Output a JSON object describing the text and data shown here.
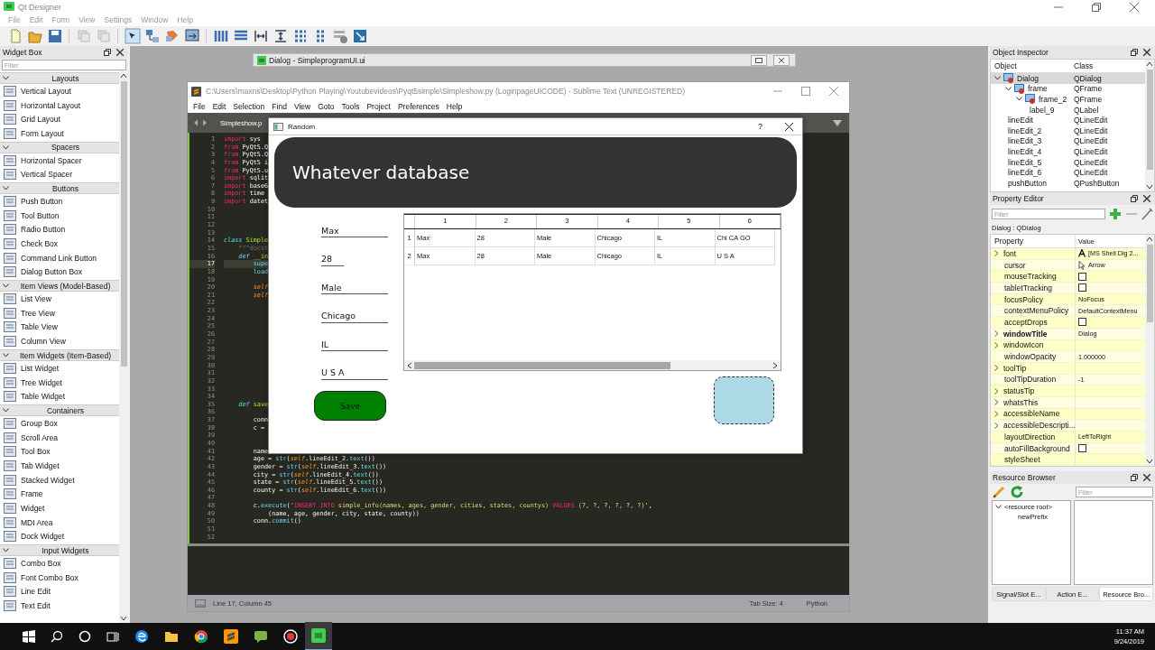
{
  "designer": {
    "title": "Qt Designer",
    "menu": [
      "File",
      "Edit",
      "Form",
      "View",
      "Settings",
      "Window",
      "Help"
    ]
  },
  "widget_box": {
    "title": "Widget Box",
    "filter_placeholder": "Filter",
    "groups": [
      {
        "label": "Layouts",
        "expanded": true,
        "items": [
          "Vertical Layout",
          "Horizontal Layout",
          "Grid Layout",
          "Form Layout"
        ]
      },
      {
        "label": "Spacers",
        "expanded": true,
        "items": [
          "Horizontal Spacer",
          "Vertical Spacer"
        ]
      },
      {
        "label": "Buttons",
        "expanded": true,
        "items": [
          "Push Button",
          "Tool Button",
          "Radio Button",
          "Check Box",
          "Command Link Button",
          "Dialog Button Box"
        ]
      },
      {
        "label": "Item Views (Model-Based)",
        "expanded": true,
        "items": [
          "List View",
          "Tree View",
          "Table View",
          "Column View"
        ]
      },
      {
        "label": "Item Widgets (Item-Based)",
        "expanded": true,
        "items": [
          "List Widget",
          "Tree Widget",
          "Table Widget"
        ]
      },
      {
        "label": "Containers",
        "expanded": true,
        "items": [
          "Group Box",
          "Scroll Area",
          "Tool Box",
          "Tab Widget",
          "Stacked Widget",
          "Frame",
          "Widget",
          "MDI Area",
          "Dock Widget"
        ]
      },
      {
        "label": "Input Widgets",
        "expanded": true,
        "items": [
          "Combo Box",
          "Font Combo Box",
          "Line Edit",
          "Text Edit"
        ]
      }
    ]
  },
  "form_window": {
    "title": "Dialog - SimpleprogramUI.ui"
  },
  "editor": {
    "title": "C:\\Users\\maxns\\Desktop\\Python Playing\\Youtubevideos\\Pyqt5simple\\Simpleshow.py (LoginpageUICODE) - Sublime Text (UNREGISTERED)",
    "menu": [
      "File",
      "Edit",
      "Selection",
      "Find",
      "View",
      "Goto",
      "Tools",
      "Project",
      "Preferences",
      "Help"
    ],
    "tab": "Simpleshow.p",
    "lines": [
      {
        "number": "1",
        "current": false,
        "segments": [
          {
            "text": "import",
            "kind": "kw"
          },
          {
            "text": " sys",
            "kind": "plain"
          }
        ]
      },
      {
        "number": "2",
        "current": false,
        "segments": [
          {
            "text": "from",
            "kind": "kw"
          },
          {
            "text": " PyQt5.Q",
            "kind": "plain"
          }
        ]
      },
      {
        "number": "3",
        "current": false,
        "segments": [
          {
            "text": "from",
            "kind": "kw"
          },
          {
            "text": " PyQt5.Q",
            "kind": "plain"
          }
        ]
      },
      {
        "number": "4",
        "current": false,
        "segments": [
          {
            "text": "from",
            "kind": "kw"
          },
          {
            "text": " PyQt5 i",
            "kind": "plain"
          }
        ]
      },
      {
        "number": "5",
        "current": false,
        "segments": [
          {
            "text": "from",
            "kind": "kw"
          },
          {
            "text": " PyQt5.u",
            "kind": "plain"
          }
        ]
      },
      {
        "number": "6",
        "current": false,
        "segments": [
          {
            "text": "import",
            "kind": "kw"
          },
          {
            "text": " sqlit",
            "kind": "plain"
          }
        ]
      },
      {
        "number": "7",
        "current": false,
        "segments": [
          {
            "text": "import",
            "kind": "kw"
          },
          {
            "text": " base6",
            "kind": "plain"
          }
        ]
      },
      {
        "number": "8",
        "current": false,
        "segments": [
          {
            "text": "import",
            "kind": "kw"
          },
          {
            "text": " time",
            "kind": "plain"
          }
        ]
      },
      {
        "number": "9",
        "current": false,
        "segments": [
          {
            "text": "import",
            "kind": "kw"
          },
          {
            "text": " datet",
            "kind": "plain"
          }
        ]
      },
      {
        "number": "10",
        "current": false
      },
      {
        "number": "11",
        "current": false
      },
      {
        "number": "12",
        "current": false
      },
      {
        "number": "13",
        "current": false
      },
      {
        "number": "14",
        "current": false,
        "segments": [
          {
            "text": "class",
            "kind": "def"
          },
          {
            "text": " Simple",
            "kind": "name"
          }
        ]
      },
      {
        "number": "15",
        "current": false,
        "segments": [
          {
            "text": "    \"\"\"docst",
            "kind": "comment"
          }
        ]
      },
      {
        "number": "16",
        "current": false,
        "segments": [
          {
            "text": "    def",
            "kind": "def"
          },
          {
            "text": " __in",
            "kind": "name"
          }
        ]
      },
      {
        "number": "17",
        "current": true,
        "segments": [
          {
            "text": "        supe",
            "kind": "fn"
          }
        ]
      },
      {
        "number": "18",
        "current": false,
        "segments": [
          {
            "text": "        load",
            "kind": "fn"
          }
        ]
      },
      {
        "number": "19",
        "current": false
      },
      {
        "number": "20",
        "current": false,
        "segments": [
          {
            "text": "        self",
            "kind": "self"
          }
        ]
      },
      {
        "number": "21",
        "current": false,
        "segments": [
          {
            "text": "        self",
            "kind": "self"
          }
        ]
      },
      {
        "number": "22",
        "current": false
      },
      {
        "number": "23",
        "current": false
      },
      {
        "number": "24",
        "current": false
      },
      {
        "number": "25",
        "current": false
      },
      {
        "number": "26",
        "current": false
      },
      {
        "number": "27",
        "current": false
      },
      {
        "number": "28",
        "current": false
      },
      {
        "number": "29",
        "current": false
      },
      {
        "number": "30",
        "current": false
      },
      {
        "number": "31",
        "current": false
      },
      {
        "number": "32",
        "current": false
      },
      {
        "number": "33",
        "current": false
      },
      {
        "number": "34",
        "current": false
      },
      {
        "number": "35",
        "current": false,
        "segments": [
          {
            "text": "    def",
            "kind": "def"
          },
          {
            "text": " save",
            "kind": "name"
          }
        ]
      },
      {
        "number": "36",
        "current": false
      },
      {
        "number": "37",
        "current": false,
        "segments": [
          {
            "text": "        conn",
            "kind": "plain"
          }
        ]
      },
      {
        "number": "38",
        "current": false,
        "segments": [
          {
            "text": "        c =",
            "kind": "plain"
          }
        ]
      },
      {
        "number": "39",
        "current": false
      },
      {
        "number": "40",
        "current": false
      },
      {
        "number": "41",
        "current": false,
        "segments": [
          {
            "text": "        name",
            "kind": "plain"
          }
        ]
      },
      {
        "number": "42",
        "current": false,
        "segments": [
          {
            "text": "        age = ",
            "kind": "plain"
          },
          {
            "text": "str",
            "kind": "fn"
          },
          {
            "text": "(",
            "kind": "plain"
          },
          {
            "text": "self",
            "kind": "self"
          },
          {
            "text": ".lineEdit_2.",
            "kind": "plain"
          },
          {
            "text": "text",
            "kind": "fn"
          },
          {
            "text": "())",
            "kind": "plain"
          }
        ]
      },
      {
        "number": "43",
        "current": false,
        "segments": [
          {
            "text": "        gender = ",
            "kind": "plain"
          },
          {
            "text": "str",
            "kind": "fn"
          },
          {
            "text": "(",
            "kind": "plain"
          },
          {
            "text": "self",
            "kind": "self"
          },
          {
            "text": ".lineEdit_3.",
            "kind": "plain"
          },
          {
            "text": "text",
            "kind": "fn"
          },
          {
            "text": "())",
            "kind": "plain"
          }
        ]
      },
      {
        "number": "44",
        "current": false,
        "segments": [
          {
            "text": "        city = ",
            "kind": "plain"
          },
          {
            "text": "str",
            "kind": "fn"
          },
          {
            "text": "(",
            "kind": "plain"
          },
          {
            "text": "self",
            "kind": "self"
          },
          {
            "text": ".lineEdit_4.",
            "kind": "plain"
          },
          {
            "text": "text",
            "kind": "fn"
          },
          {
            "text": "())",
            "kind": "plain"
          }
        ]
      },
      {
        "number": "45",
        "current": false,
        "segments": [
          {
            "text": "        state = ",
            "kind": "plain"
          },
          {
            "text": "str",
            "kind": "fn"
          },
          {
            "text": "(",
            "kind": "plain"
          },
          {
            "text": "self",
            "kind": "self"
          },
          {
            "text": ".lineEdit_5.",
            "kind": "plain"
          },
          {
            "text": "text",
            "kind": "fn"
          },
          {
            "text": "())",
            "kind": "plain"
          }
        ]
      },
      {
        "number": "46",
        "current": false,
        "segments": [
          {
            "text": "        county = ",
            "kind": "plain"
          },
          {
            "text": "str",
            "kind": "fn"
          },
          {
            "text": "(",
            "kind": "plain"
          },
          {
            "text": "self",
            "kind": "self"
          },
          {
            "text": ".lineEdit_6.",
            "kind": "plain"
          },
          {
            "text": "text",
            "kind": "fn"
          },
          {
            "text": "())",
            "kind": "plain"
          }
        ]
      },
      {
        "number": "47",
        "current": false
      },
      {
        "number": "48",
        "current": false,
        "segments": [
          {
            "text": "        c.",
            "kind": "plain"
          },
          {
            "text": "execute",
            "kind": "fn"
          },
          {
            "text": "(",
            "kind": "plain"
          },
          {
            "text": "'",
            "kind": "str"
          },
          {
            "text": "INSERT INTO",
            "kind": "kw"
          },
          {
            "text": " simple_info(names, ages, gender, cities, states, countys) ",
            "kind": "str"
          },
          {
            "text": "VALUES",
            "kind": "kw"
          },
          {
            "text": " (?, ?, ?, ?, ?, ?)'",
            "kind": "str"
          },
          {
            "text": ",",
            "kind": "plain"
          }
        ]
      },
      {
        "number": "49",
        "current": false,
        "segments": [
          {
            "text": "            (name, age, gender, city, state, county))",
            "kind": "plain"
          }
        ]
      },
      {
        "number": "50",
        "current": false,
        "segments": [
          {
            "text": "        conn.",
            "kind": "plain"
          },
          {
            "text": "commit",
            "kind": "fn"
          },
          {
            "text": "()",
            "kind": "plain"
          }
        ]
      },
      {
        "number": "51",
        "current": false
      },
      {
        "number": "52",
        "current": false
      }
    ],
    "status": {
      "position": "Line 17, Column 45",
      "tab_size": "Tab Size: 4",
      "syntax": "Python"
    }
  },
  "dialog": {
    "title": "Random",
    "help": "?",
    "heading": "Whatever database",
    "fields": [
      "Max",
      "28",
      "Male",
      "Chicago",
      "IL",
      "U S A"
    ],
    "save_button": "Save",
    "table": {
      "columns": [
        "1",
        "2",
        "3",
        "4",
        "5",
        "6"
      ],
      "rows": [
        {
          "header": "1",
          "cells": [
            "Max",
            "28",
            "Male",
            "Chicago",
            "IL",
            "Chi CA GO"
          ]
        },
        {
          "header": "2",
          "cells": [
            "Max",
            "28",
            "Male",
            "Chicago",
            "IL",
            "U S A"
          ]
        }
      ]
    }
  },
  "object_inspector": {
    "title": "Object Inspector",
    "columns": [
      "Object",
      "Class"
    ],
    "objects": [
      {
        "name": "Dialog",
        "class": "QDialog",
        "selected": true,
        "expanded": true,
        "children": [
          {
            "name": "frame",
            "class": "QFrame",
            "selected": false,
            "expanded": true,
            "children": [
              {
                "name": "frame_2",
                "class": "QFrame",
                "selected": false,
                "expanded": true,
                "children": [
                  {
                    "name": "label_9",
                    "class": "QLabel",
                    "selected": false
                  }
                ]
              }
            ]
          },
          {
            "name": "lineEdit",
            "class": "QLineEdit",
            "selected": false
          },
          {
            "name": "lineEdit_2",
            "class": "QLineEdit",
            "selected": false
          },
          {
            "name": "lineEdit_3",
            "class": "QLineEdit",
            "selected": false
          },
          {
            "name": "lineEdit_4",
            "class": "QLineEdit",
            "selected": false
          },
          {
            "name": "lineEdit_5",
            "class": "QLineEdit",
            "selected": false
          },
          {
            "name": "lineEdit_6",
            "class": "QLineEdit",
            "selected": false
          },
          {
            "name": "pushButton",
            "class": "QPushButton",
            "selected": false
          }
        ]
      }
    ]
  },
  "property_editor": {
    "title": "Property Editor",
    "filter_placeholder": "Filter",
    "object": "Dialog : QDialog",
    "columns": [
      "Property",
      "Value"
    ],
    "properties": [
      {
        "name": "font",
        "kind": "font",
        "value": "[MS Shell Dlg 2...",
        "expandable": true,
        "modified": false
      },
      {
        "name": "cursor",
        "kind": "cursor",
        "value": "Arrow",
        "expandable": false,
        "modified": false
      },
      {
        "name": "mouseTracking",
        "kind": "checkbox",
        "checked": false,
        "expandable": false,
        "modified": false
      },
      {
        "name": "tabletTracking",
        "kind": "checkbox",
        "checked": false,
        "expandable": false,
        "modified": false
      },
      {
        "name": "focusPolicy",
        "kind": "text",
        "value": "NoFocus",
        "expandable": false,
        "modified": false
      },
      {
        "name": "contextMenuPolicy",
        "kind": "text",
        "value": "DefaultContextMenu",
        "expandable": false,
        "modified": false
      },
      {
        "name": "acceptDrops",
        "kind": "checkbox",
        "checked": false,
        "expandable": false,
        "modified": false
      },
      {
        "name": "windowTitle",
        "kind": "text",
        "value": "Dialog",
        "expandable": true,
        "modified": true
      },
      {
        "name": "windowIcon",
        "kind": "text",
        "expandable": true,
        "modified": false
      },
      {
        "name": "windowOpacity",
        "kind": "text",
        "value": "1.000000",
        "expandable": false,
        "modified": false
      },
      {
        "name": "toolTip",
        "kind": "text",
        "expandable": true,
        "modified": false
      },
      {
        "name": "toolTipDuration",
        "kind": "text",
        "value": "-1",
        "expandable": false,
        "modified": false
      },
      {
        "name": "statusTip",
        "kind": "text",
        "expandable": true,
        "modified": false
      },
      {
        "name": "whatsThis",
        "kind": "text",
        "expandable": true,
        "modified": false
      },
      {
        "name": "accessibleName",
        "kind": "text",
        "expandable": true,
        "modified": false
      },
      {
        "name": "accessibleDescripti...",
        "kind": "text",
        "expandable": true,
        "modified": false
      },
      {
        "name": "layoutDirection",
        "kind": "text",
        "value": "LeftToRight",
        "expandable": false,
        "modified": false
      },
      {
        "name": "autoFillBackground",
        "kind": "checkbox",
        "checked": false,
        "expandable": false,
        "modified": false
      },
      {
        "name": "styleSheet",
        "kind": "text",
        "expandable": false,
        "modified": false
      }
    ]
  },
  "resource_browser": {
    "title": "Resource Browser",
    "filter_placeholder": "Filter",
    "root": "<resource root>",
    "root_expanded": true,
    "prefixes": [
      "newPrefix"
    ]
  },
  "dock_tabs": [
    {
      "label": "Signal/Slot E...",
      "selected": false
    },
    {
      "label": "Action E...",
      "selected": false
    },
    {
      "label": "Resource Bro...",
      "selected": true
    }
  ],
  "taskbar": {
    "time": "11:37 AM",
    "date": "9/24/2019"
  }
}
